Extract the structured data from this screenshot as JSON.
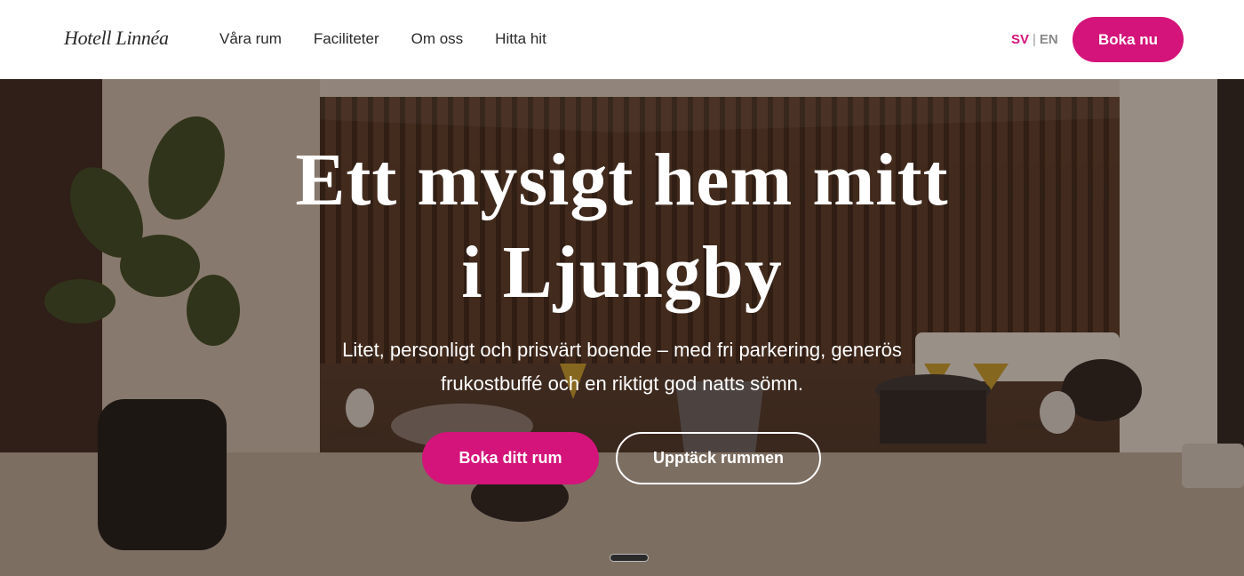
{
  "header": {
    "logo_text": "Hotell Linnéa",
    "nav": [
      {
        "label": "Våra rum"
      },
      {
        "label": "Faciliteter"
      },
      {
        "label": "Om oss"
      },
      {
        "label": "Hitta hit"
      }
    ],
    "lang_active": "SV",
    "lang_separator": "|",
    "lang_inactive": "EN",
    "book_label": "Boka nu"
  },
  "hero": {
    "title_line1": "Ett mysigt hem mitt",
    "title_line2": "i Ljungby",
    "subtitle_line1": "Litet, personligt och prisvärt boende – med fri parkering, generös",
    "subtitle_line2": "frukostbuffé och en riktigt god natts sömn.",
    "primary_button": "Boka ditt rum",
    "secondary_button": "Upptäck rummen"
  },
  "colors": {
    "accent": "#d4147a",
    "nav_text": "#2a2a2a",
    "inactive_lang": "#8a8a8a"
  }
}
